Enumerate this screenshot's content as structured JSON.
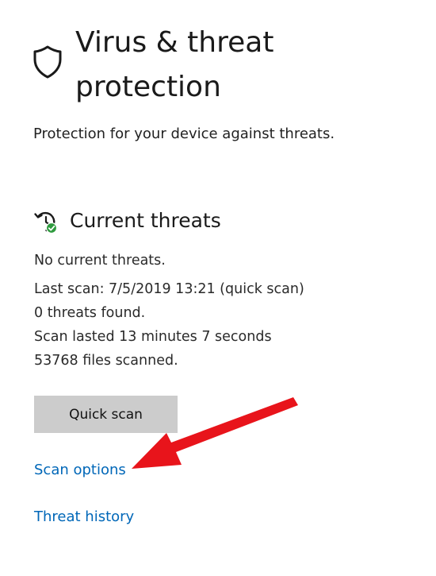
{
  "header": {
    "icon": "shield-icon",
    "title": "Virus & threat protection",
    "subtitle": "Protection for your device against threats."
  },
  "current_threats": {
    "icon": "clock-check-icon",
    "title": "Current threats",
    "status": "No current threats.",
    "last_scan": "Last scan: 7/5/2019 13:21 (quick scan)",
    "threats_found": "0 threats found.",
    "duration": "Scan lasted 13 minutes 7 seconds",
    "files_scanned": "53768 files scanned."
  },
  "actions": {
    "quick_scan_label": "Quick scan",
    "scan_options_label": "Scan options",
    "threat_history_label": "Threat history"
  },
  "annotation": {
    "arrow_color": "#e8141b",
    "arrow_target": "scan-options-link"
  },
  "colors": {
    "link": "#0067b8",
    "button_bg": "#cccccc",
    "check_badge": "#2e9a3e"
  }
}
